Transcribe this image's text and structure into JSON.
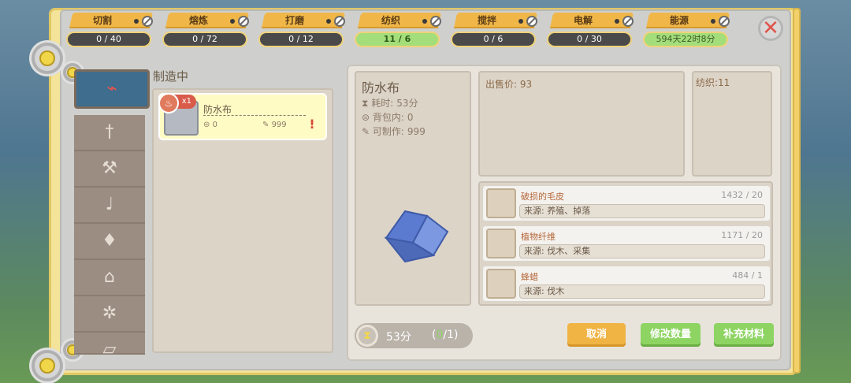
{
  "tabs": [
    {
      "label": "切割",
      "value": "0 / 40",
      "state": "normal"
    },
    {
      "label": "熔炼",
      "value": "0 / 72",
      "state": "normal"
    },
    {
      "label": "打磨",
      "value": "0 / 12",
      "state": "normal"
    },
    {
      "label": "纺织",
      "value": "11 / 6",
      "state": "full"
    },
    {
      "label": "搅拌",
      "value": "0 / 6",
      "state": "normal"
    },
    {
      "label": "电解",
      "value": "0 / 30",
      "state": "normal"
    },
    {
      "label": "能源",
      "value": "594天22时8分",
      "state": "energy"
    }
  ],
  "sidebar_icons": [
    "broom-icon",
    "knife-icon",
    "pickaxe-icon",
    "hose-icon",
    "potion-icon",
    "furnace-icon",
    "gear-icon",
    "misc-icon"
  ],
  "queue": {
    "title": "制造中",
    "item": {
      "name": "防水布",
      "badge": "x1",
      "owned": "0",
      "craftable": "999",
      "warn": "!"
    }
  },
  "detail": {
    "name": "防水布",
    "time_label": "耗时:",
    "time_value": "53分",
    "bag_label": "背包内:",
    "bag_value": "0",
    "craft_label": "可制作:",
    "craft_value": "999",
    "sell_label": "出售价:",
    "sell_value": "93",
    "weave_label": "纺织:",
    "weave_value": "11"
  },
  "materials": [
    {
      "name": "破损的毛皮",
      "count": "1432 / 20",
      "source": "来源: 养殖、掉落"
    },
    {
      "name": "植物纤维",
      "count": "1171 / 20",
      "source": "来源: 伐木、采集"
    },
    {
      "name": "蜂蜡",
      "count": "484 / 1",
      "source": "来源: 伐木"
    }
  ],
  "timer": {
    "time": "53分",
    "done": "0",
    "total": "1"
  },
  "buttons": {
    "cancel": "取消",
    "change_qty": "修改数量",
    "refill": "补充材料"
  },
  "colors": {
    "tab_orange": "#f0b748",
    "green_button": "#8ed463",
    "orange_button": "#f0b445",
    "accent_red": "#d95c4a"
  }
}
